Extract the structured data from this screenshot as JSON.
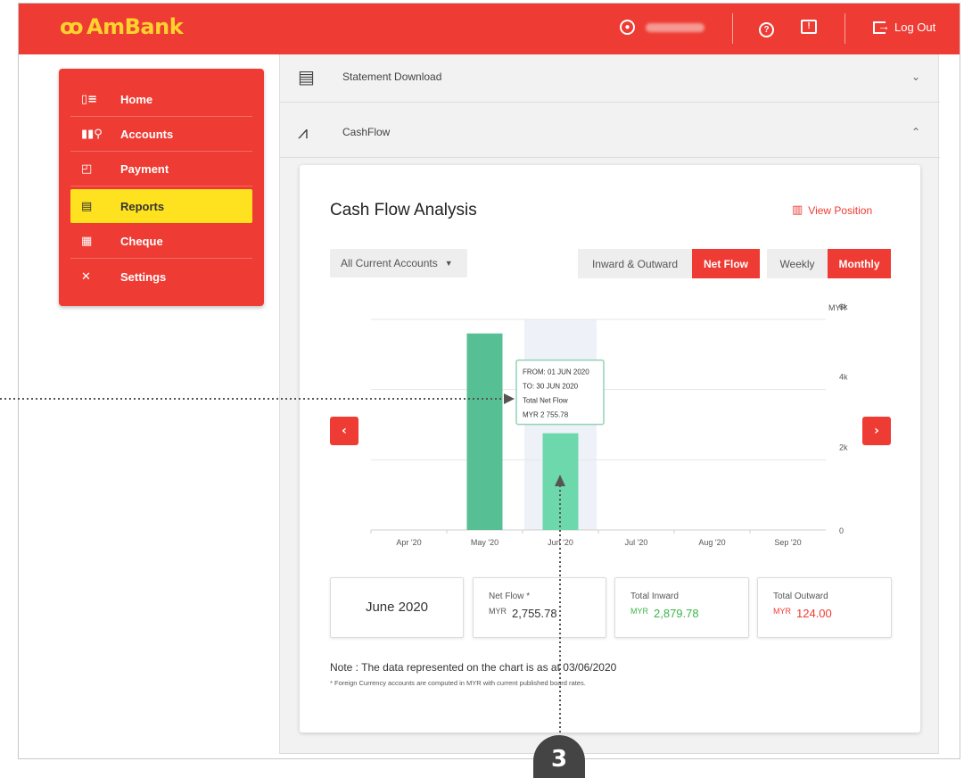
{
  "app": {
    "brand": "AmBank",
    "logo_mark": "ꝏ",
    "logout_label": "Log Out",
    "user_icon": "user-circle-icon",
    "help_icon": "question-circle-icon",
    "message_icon": "message-alert-icon",
    "accent": "#ee3b33",
    "highlight": "#ffe21f"
  },
  "sidebar": {
    "items": [
      {
        "label": "Home",
        "icon": "▯≡",
        "active": false
      },
      {
        "label": "Accounts",
        "icon": "▮▮⚲",
        "active": false
      },
      {
        "label": "Payment",
        "icon": "◰",
        "active": false
      },
      {
        "label": "Reports",
        "icon": "▤",
        "active": true
      },
      {
        "label": "Cheque",
        "icon": "▦",
        "active": false
      },
      {
        "label": "Settings",
        "icon": "✕",
        "active": false
      }
    ]
  },
  "accordion": {
    "statement_label": "Statement Download",
    "cashflow_label": "CashFlow"
  },
  "card": {
    "title": "Cash Flow Analysis",
    "view_position_label": "View Position",
    "account_select": "All Current Accounts",
    "flow_toggle": [
      "Inward & Outward",
      "Net Flow"
    ],
    "flow_selected": "Net Flow",
    "period_toggle": [
      "Weekly",
      "Monthly"
    ],
    "period_selected": "Monthly",
    "prev_label": "‹",
    "next_label": "›"
  },
  "chart_data": {
    "type": "bar",
    "categories": [
      "Apr '20",
      "May '20",
      "Jun '20",
      "Jul '20",
      "Aug '20",
      "Sep '20"
    ],
    "values": [
      0,
      5600,
      2755.78,
      0,
      0,
      0
    ],
    "highlighted": "Jun '20",
    "yunit": "MYR",
    "yticks": [
      "0",
      "2k",
      "4k",
      "6k"
    ],
    "ylim": [
      0,
      6000
    ],
    "bar_colors": {
      "default": "#56bf94",
      "highlighted": "#6dd8ac"
    },
    "tooltip": {
      "from": "FROM: 01 JUN 2020",
      "to": "TO: 30 JUN 2020",
      "label": "Total Net Flow",
      "value": "MYR 2 755.78"
    }
  },
  "summary": {
    "month": "June 2020",
    "net_flow_label": "Net Flow *",
    "net_flow_currency": "MYR",
    "net_flow_value": "2,755.78",
    "inward_label": "Total Inward",
    "inward_currency": "MYR",
    "inward_value": "2,879.78",
    "outward_label": "Total Outward",
    "outward_currency": "MYR",
    "outward_value": "124.00"
  },
  "notes": {
    "main": "Note : The data represented on the chart is as at 03/06/2020",
    "small": "* Foreign Currency accounts are computed in MYR with current published board rates."
  },
  "annotation": {
    "number": "3"
  }
}
